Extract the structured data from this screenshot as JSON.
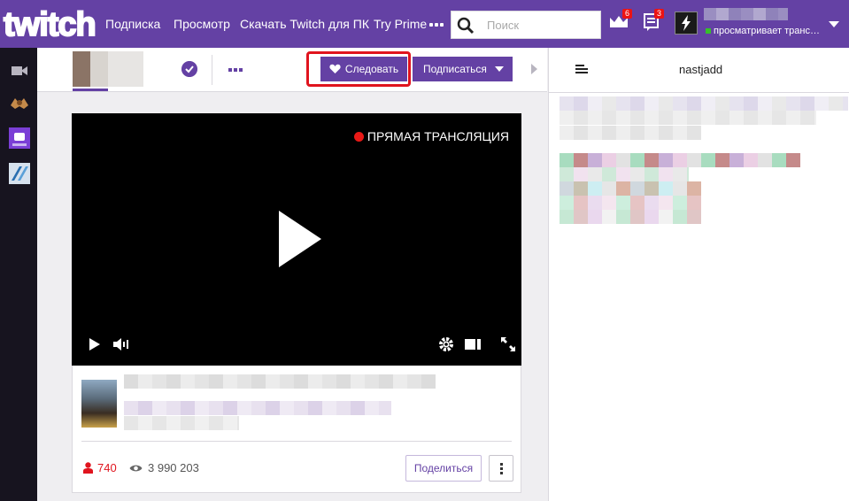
{
  "nav": {
    "logo_text": "twitch",
    "links": [
      "Подписка",
      "Просмотр",
      "Скачать Twitch для ПК",
      "Try Prime"
    ],
    "search_placeholder": "Поиск",
    "prime_badge": "6",
    "notif_badge": "3",
    "user_status": "просматривает транс…"
  },
  "sidebar": {
    "items": [
      "video-camera-icon",
      "channel-avatar-1",
      "channel-avatar-2",
      "channel-avatar-3"
    ]
  },
  "channel": {
    "follow_label": "Следовать",
    "subscribe_label": "Подписаться"
  },
  "player": {
    "live_label": "ПРЯМАЯ ТРАНСЛЯЦИЯ"
  },
  "info": {
    "viewers": "740",
    "views": "3 990 203",
    "share_label": "Поделиться"
  },
  "chat": {
    "title": "nastjadd"
  },
  "colors": {
    "brand": "#6441a4",
    "live": "#e91916",
    "highlight": "#e0141e"
  }
}
